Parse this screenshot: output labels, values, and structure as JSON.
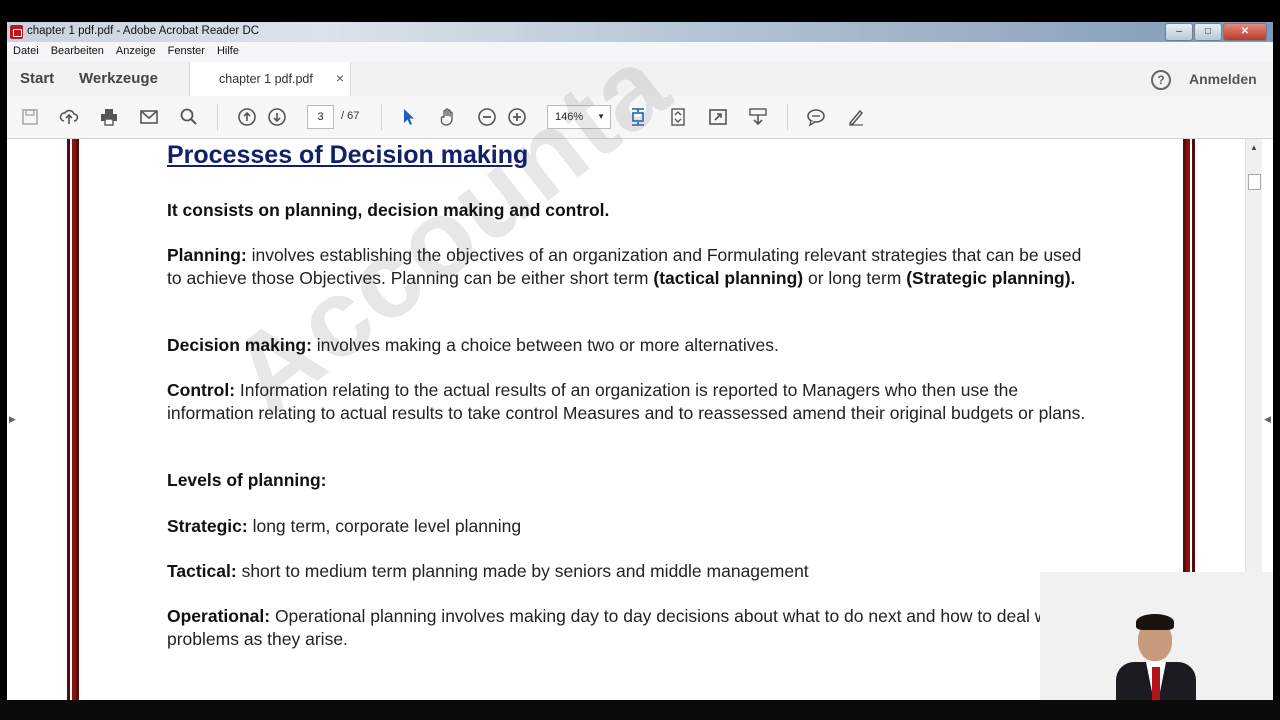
{
  "window": {
    "title": "chapter 1 pdf.pdf - Adobe Acrobat Reader DC",
    "controls": [
      "–",
      "□",
      "✕"
    ]
  },
  "menu": [
    "Datei",
    "Bearbeiten",
    "Anzeige",
    "Fenster",
    "Hilfe"
  ],
  "tabs": {
    "start": "Start",
    "tools": "Werkzeuge",
    "document": "chapter 1 pdf.pdf",
    "close": "×"
  },
  "help_label": "?",
  "signin_label": "Anmelden",
  "toolbar": {
    "current_page": "3",
    "total_pages": "/ 67",
    "zoom": "146%",
    "zoom_arrow": "▼"
  },
  "icons": [
    "save-icon",
    "upload-icon",
    "print-icon",
    "email-icon",
    "search-icon",
    "page-up-icon",
    "page-down-icon",
    "select-pointer-icon",
    "hand-icon",
    "zoom-out-icon",
    "zoom-in-icon",
    "fit-page-icon",
    "rotate-icon",
    "fullscreen-icon",
    "read-mode-icon",
    "comment-icon",
    "sign-icon"
  ],
  "document": {
    "watermark": "Accounta",
    "heading": "Processes of Decision making",
    "intro": "It consists on planning, decision making and control.",
    "planning": {
      "label": "Planning:",
      "text1": " involves establishing the objectives of an organization and Formulating relevant strategies that can be used to achieve those Objectives. Planning can be either short term ",
      "bold1": "(tactical planning)",
      "text2": " or long term ",
      "bold2": "(Strategic planning)."
    },
    "decision": {
      "label": "Decision making:",
      "text": " involves making a choice between two or more alternatives."
    },
    "control": {
      "label": "Control:",
      "text": " Information relating to the actual results of an organization is reported to Managers who then use the information relating to actual results to take control Measures and to reassessed amend their original budgets or plans."
    },
    "levels_heading": "Levels of planning:",
    "strategic": {
      "label": "Strategic:",
      "text": " long term, corporate level planning"
    },
    "tactical": {
      "label": "Tactical:",
      "text": " short to medium term planning made by seniors and middle management"
    },
    "operational": {
      "label": "Operational:",
      "text": " Operational planning involves making day to day decisions about what to do next and how to deal with problems as they arise."
    }
  },
  "colors": {
    "heading": "#10206a",
    "border_deco": "#8b1010"
  }
}
